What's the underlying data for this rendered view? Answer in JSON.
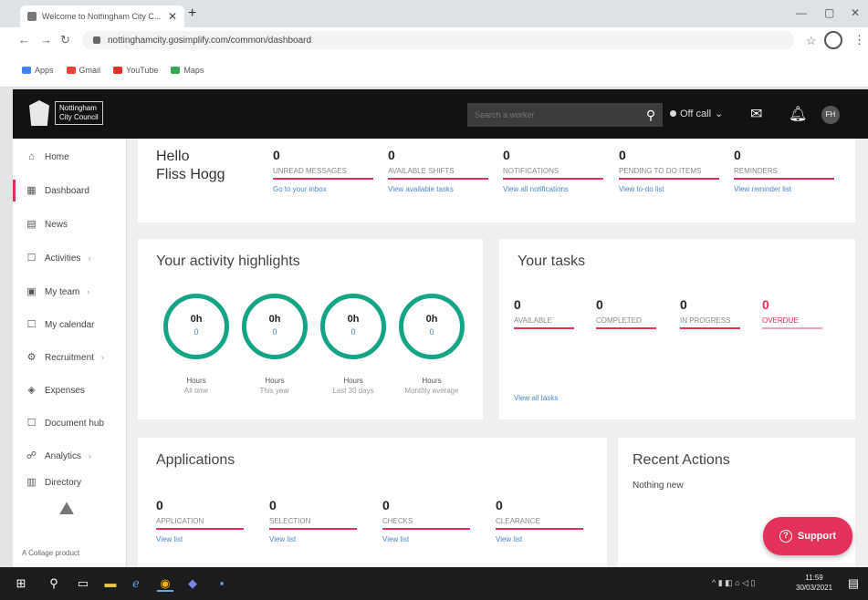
{
  "browser": {
    "tab_title": "Welcome to Nottingham City C...",
    "tab_close": "✕",
    "new_tab": "+",
    "url": "nottinghamcity.gosimplify.com/common/dashboard",
    "bookmarks": [
      {
        "label": "Apps",
        "color": "#4285f4"
      },
      {
        "label": "Gmail",
        "color": "#ea4335"
      },
      {
        "label": "YouTube",
        "color": "#e52d27"
      },
      {
        "label": "Maps",
        "color": "#34a853"
      }
    ]
  },
  "header": {
    "logo_line1": "Nottingham",
    "logo_line2": "City Council",
    "search_placeholder": "Search a worker",
    "status": "Off call",
    "avatar_initials": "FH"
  },
  "sidebar": {
    "items": [
      {
        "label": "Home",
        "icon": "⌂",
        "chevron": ""
      },
      {
        "label": "Dashboard",
        "icon": "▦",
        "chevron": ""
      },
      {
        "label": "News",
        "icon": "▤",
        "chevron": ""
      },
      {
        "label": "Activities",
        "icon": "☐",
        "chevron": "›"
      },
      {
        "label": "My team",
        "icon": "▣",
        "chevron": "›"
      },
      {
        "label": "My calendar",
        "icon": "☐",
        "chevron": ""
      },
      {
        "label": "Recruitment",
        "icon": "⚙",
        "chevron": "›"
      },
      {
        "label": "Expenses",
        "icon": "◈",
        "chevron": ""
      },
      {
        "label": "Document hub",
        "icon": "☐",
        "chevron": ""
      },
      {
        "label": "Analytics",
        "icon": "☍",
        "chevron": "›"
      },
      {
        "label": "Directory",
        "icon": "▥",
        "chevron": ""
      }
    ],
    "footer": "A Collage product"
  },
  "welcome": {
    "greeting": "Hello",
    "name": "Fliss Hogg",
    "stats": [
      {
        "value": "0",
        "label": "Unread messages",
        "link": "Go to your inbox"
      },
      {
        "value": "0",
        "label": "Available shifts",
        "link": "View available tasks"
      },
      {
        "value": "0",
        "label": "Notifications",
        "link": "View all notifications"
      },
      {
        "value": "0",
        "label": "Pending to do items",
        "link": "View to-do list"
      },
      {
        "value": "0",
        "label": "Reminders",
        "link": "View reminder list"
      }
    ]
  },
  "highlights": {
    "title": "Your activity highlights",
    "rings": [
      {
        "value": "0h",
        "sub": "0",
        "caption": "Hours",
        "period": "All time"
      },
      {
        "value": "0h",
        "sub": "0",
        "caption": "Hours",
        "period": "This year"
      },
      {
        "value": "0h",
        "sub": "0",
        "caption": "Hours",
        "period": "Last 30 days"
      },
      {
        "value": "0h",
        "sub": "0",
        "caption": "Hours",
        "period": "Monthly average"
      }
    ]
  },
  "tasks": {
    "title": "Your tasks",
    "stats": [
      {
        "value": "0",
        "label": "Available"
      },
      {
        "value": "0",
        "label": "Completed"
      },
      {
        "value": "0",
        "label": "In progress"
      },
      {
        "value": "0",
        "label": "Overdue"
      }
    ],
    "view_all": "View all tasks"
  },
  "applications": {
    "title": "Applications",
    "stats": [
      {
        "value": "0",
        "label": "Application",
        "link": "View list"
      },
      {
        "value": "0",
        "label": "Selection",
        "link": "View list"
      },
      {
        "value": "0",
        "label": "Checks",
        "link": "View list"
      },
      {
        "value": "0",
        "label": "Clearance",
        "link": "View list"
      }
    ]
  },
  "recent": {
    "title": "Recent Actions",
    "empty": "Nothing new"
  },
  "support": {
    "label": "Support"
  },
  "taskbar": {
    "time": "11:59",
    "date": "30/03/2021"
  },
  "colors": {
    "accent": "#e4315a",
    "ring": "#13a585",
    "link": "#4a86c5"
  }
}
